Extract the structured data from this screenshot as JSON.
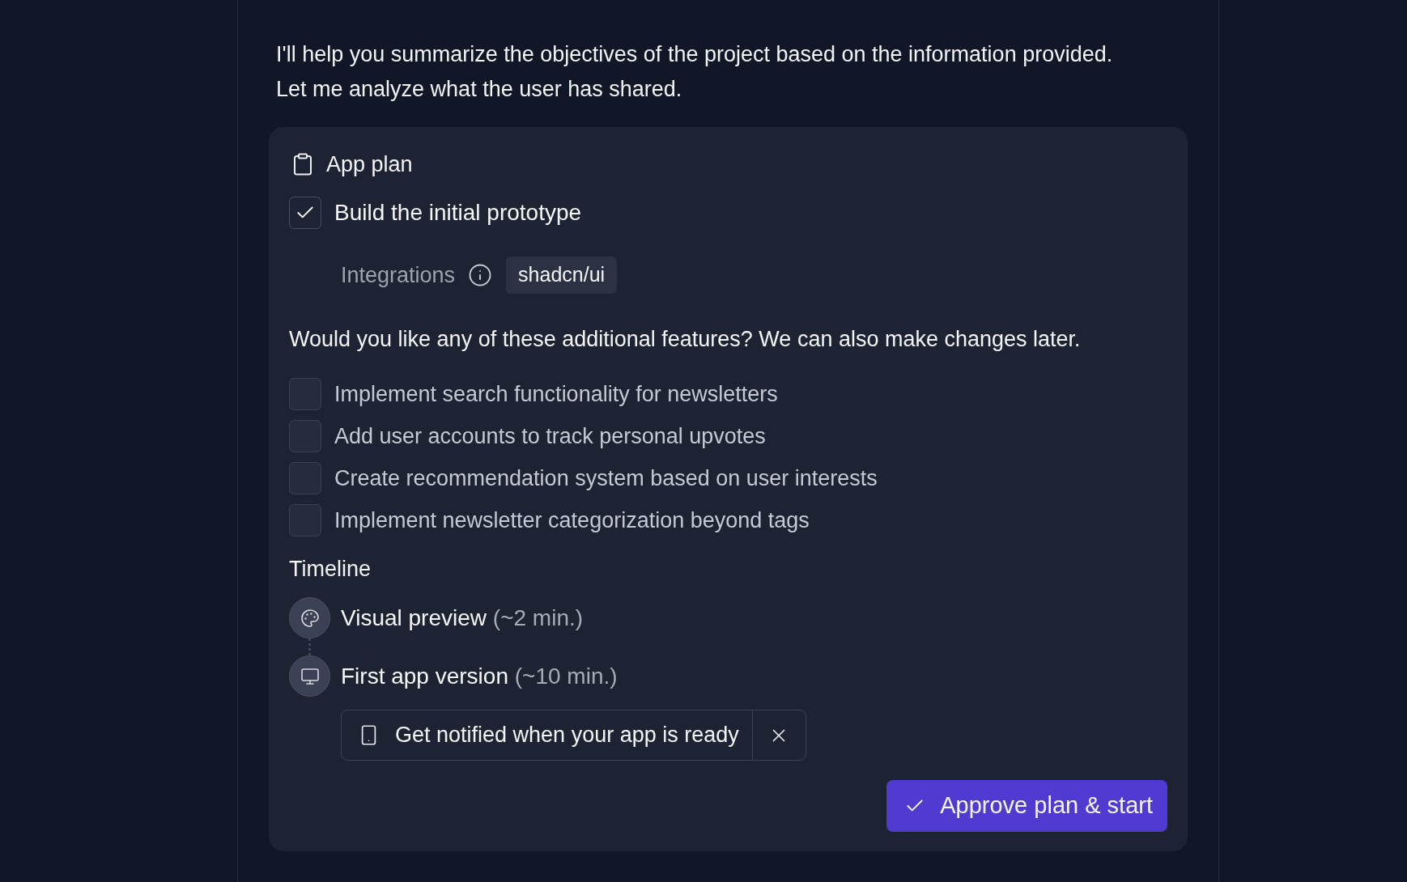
{
  "message": {
    "text": "I'll help you summarize the objectives of the project based on the information provided. Let me analyze what the user has shared."
  },
  "plan": {
    "title": "App plan",
    "tasks": [
      {
        "label": "Build the initial prototype",
        "checked": true
      }
    ],
    "integrations": {
      "label": "Integrations",
      "badges": [
        "shadcn/ui"
      ]
    },
    "question": "Would you like any of these additional features? We can also make changes later.",
    "features": [
      {
        "label": "Implement search functionality for newsletters",
        "checked": false
      },
      {
        "label": "Add user accounts to track personal upvotes",
        "checked": false
      },
      {
        "label": "Create recommendation system based on user interests",
        "checked": false
      },
      {
        "label": "Implement newsletter categorization beyond tags",
        "checked": false
      }
    ],
    "timeline": {
      "title": "Timeline",
      "steps": [
        {
          "label": "Visual preview",
          "duration": "(~2 min.)"
        },
        {
          "label": "First app version",
          "duration": "(~10 min.)"
        }
      ]
    },
    "notification": {
      "text": "Get notified when your app is ready"
    },
    "approve_button": {
      "label": "Approve plan & start"
    }
  }
}
